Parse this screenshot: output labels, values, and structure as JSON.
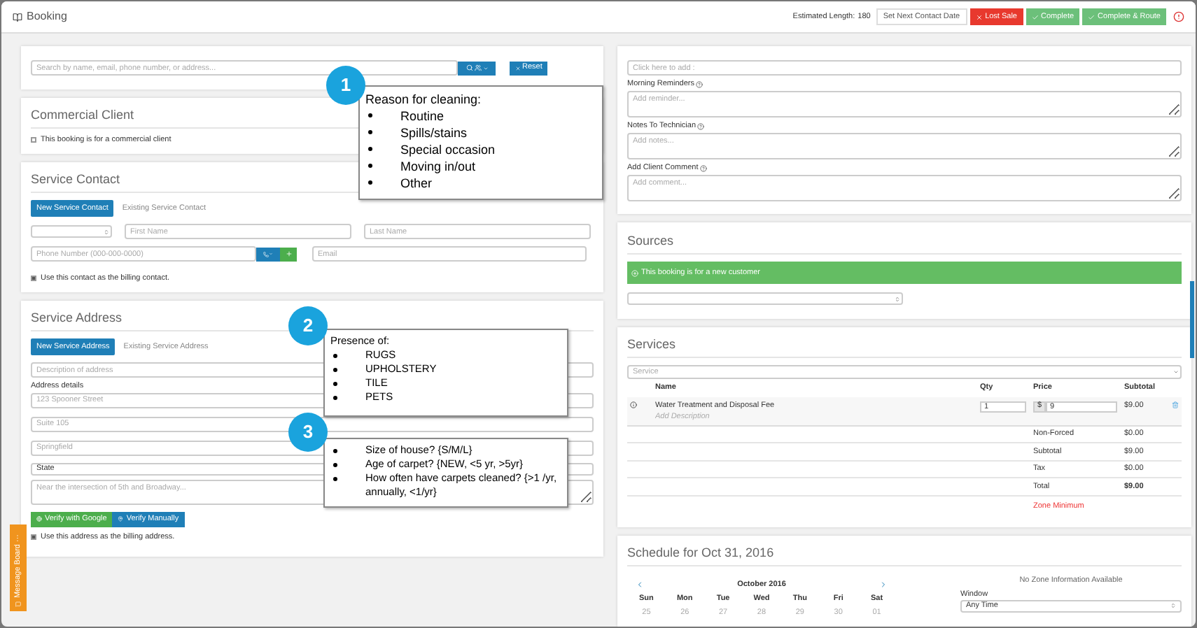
{
  "header": {
    "title": "Booking",
    "estimated_label": "Estimated Length:",
    "estimated_value": "180",
    "actions": [
      {
        "label": "Set Next Contact Date",
        "kind": "plain"
      },
      {
        "label": "Lost Sale",
        "kind": "danger"
      },
      {
        "label": "Complete",
        "kind": "success"
      },
      {
        "label": "Complete & Route",
        "kind": "success"
      }
    ]
  },
  "search": {
    "placeholder": "Search by name, email, phone number, or address...",
    "reset": "Reset"
  },
  "commercial": {
    "title": "Commercial Client",
    "checkbox": {
      "label": "This booking is for a commercial client",
      "checked": false
    }
  },
  "contact": {
    "title": "Service Contact",
    "tabs": [
      {
        "label": "New Service Contact",
        "selected": true
      },
      {
        "label": "Existing Service Contact",
        "selected": false
      }
    ],
    "first_name": {
      "placeholder": "First Name"
    },
    "last_name": {
      "placeholder": "Last Name"
    },
    "phone": {
      "placeholder": "Phone Number (000-000-0000)"
    },
    "email": {
      "placeholder": "Email"
    },
    "billing": {
      "label": "Use this contact as the billing contact.",
      "checked": true
    }
  },
  "address": {
    "title": "Service Address",
    "tabs": [
      {
        "label": "New Service Address",
        "selected": true
      },
      {
        "label": "Existing Service Address",
        "selected": false
      }
    ],
    "description": {
      "placeholder": "Description of address"
    },
    "details_label": "Address details",
    "fields": [
      {
        "placeholder": "123 Spooner Street"
      },
      {
        "placeholder": "Suite 105"
      },
      {
        "placeholder": "Springfield"
      }
    ],
    "state": "State",
    "notes": {
      "placeholder": "Near the intersection of 5th and Broadway..."
    },
    "verify_google": "Verify with Google",
    "verify_manual": "Verify Manually",
    "billing": {
      "label": "Use this address as the billing address.",
      "checked": true
    }
  },
  "message_board": "Message Board ···",
  "callouts": [
    {
      "number": "1",
      "title": "Reason for cleaning:",
      "items": [
        "Routine",
        "Spills/stains",
        "Special occasion",
        "Moving in/out",
        "Other"
      ]
    },
    {
      "number": "2",
      "title": "Presence of:",
      "items": [
        "RUGS",
        "UPHOLSTERY",
        "TILE",
        "PETS"
      ]
    },
    {
      "number": "3",
      "items": [
        "Size of house? {S/M/L}",
        "Age of carpet? {NEW, <5 yr, >5yr}",
        "How often have carpets cleaned? {>1 /yr, annually, <1/yr}"
      ]
    }
  ],
  "notes": {
    "add": {
      "placeholder": "Click here to add :"
    },
    "fields": [
      {
        "label": "Morning Reminders",
        "placeholder": "Add reminder..."
      },
      {
        "label": "Notes To Technician",
        "placeholder": "Add notes..."
      },
      {
        "label": "Add Client Comment",
        "placeholder": "Add comment..."
      }
    ]
  },
  "sources": {
    "title": "Sources",
    "alert": "This booking is for a new customer"
  },
  "services": {
    "title": "Services",
    "select": {
      "placeholder": "Service"
    },
    "columns": [
      "Name",
      "Qty",
      "Price",
      "Subtotal"
    ],
    "rows": [
      {
        "name": "Water Treatment and Disposal Fee",
        "description": {
          "placeholder": "Add Description"
        },
        "qty": "1",
        "currency": "$",
        "price": "9",
        "subtotal": "$9.00"
      }
    ],
    "totals": [
      {
        "label": "Non-Forced",
        "value": "$0.00",
        "kind": "line"
      },
      {
        "label": "Subtotal",
        "value": "$9.00",
        "kind": "line"
      },
      {
        "label": "Tax",
        "value": "$0.00",
        "kind": "line"
      },
      {
        "label": "Total",
        "value": "$9.00",
        "kind": "total"
      }
    ],
    "zone_minimum": "Zone Minimum"
  },
  "schedule": {
    "title": "Schedule for Oct 31, 2016",
    "month": "October 2016",
    "days": [
      "Sun",
      "Mon",
      "Tue",
      "Wed",
      "Thu",
      "Fri",
      "Sat"
    ],
    "dates": [
      "25",
      "26",
      "27",
      "28",
      "29",
      "30",
      "01"
    ],
    "zone_info": "No Zone Information Available",
    "window_label": "Window",
    "window_value": "Any Time"
  }
}
